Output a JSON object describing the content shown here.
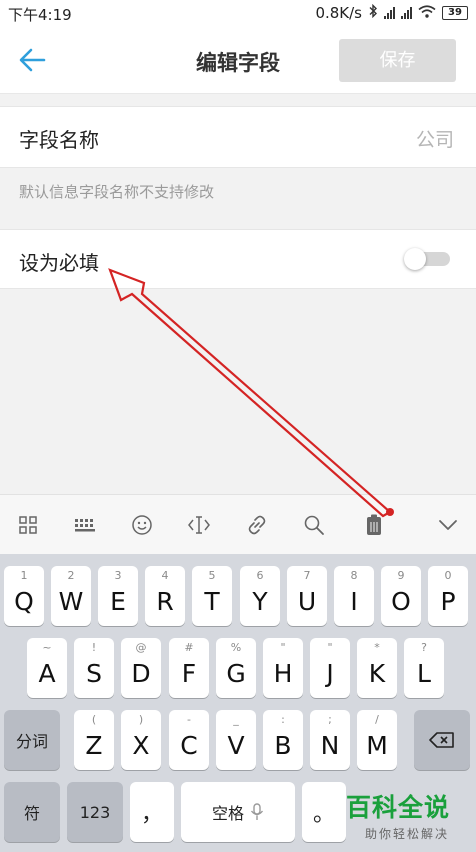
{
  "status_bar": {
    "time": "下午4:19",
    "speed": "0.8K/s",
    "battery": "39"
  },
  "header": {
    "title": "编辑字段",
    "save_label": "保存",
    "accent_color": "#2f9fdc"
  },
  "form": {
    "field_name_label": "字段名称",
    "field_name_value": "公司",
    "hint": "默认信息字段名称不支持修改",
    "required_label": "设为必填",
    "required_on": false
  },
  "keyboard": {
    "toolbar": [
      "grid-icon",
      "keyboard-icon",
      "emoji-icon",
      "cursor-icon",
      "link-icon",
      "search-icon",
      "clipboard-icon",
      "collapse-icon"
    ],
    "row1": [
      {
        "main": "Q",
        "sub": "1"
      },
      {
        "main": "W",
        "sub": "2"
      },
      {
        "main": "E",
        "sub": "3"
      },
      {
        "main": "R",
        "sub": "4"
      },
      {
        "main": "T",
        "sub": "5"
      },
      {
        "main": "Y",
        "sub": "6"
      },
      {
        "main": "U",
        "sub": "7"
      },
      {
        "main": "I",
        "sub": "8"
      },
      {
        "main": "O",
        "sub": "9"
      },
      {
        "main": "P",
        "sub": "0"
      }
    ],
    "row2": [
      {
        "main": "A",
        "sub": "~"
      },
      {
        "main": "S",
        "sub": "!"
      },
      {
        "main": "D",
        "sub": "@"
      },
      {
        "main": "F",
        "sub": "#"
      },
      {
        "main": "G",
        "sub": "%"
      },
      {
        "main": "H",
        "sub": "\""
      },
      {
        "main": "J",
        "sub": "\""
      },
      {
        "main": "K",
        "sub": "*"
      },
      {
        "main": "L",
        "sub": "?"
      }
    ],
    "row3": [
      {
        "main": "Z",
        "sub": "("
      },
      {
        "main": "X",
        "sub": ")"
      },
      {
        "main": "C",
        "sub": "-"
      },
      {
        "main": "V",
        "sub": "_"
      },
      {
        "main": "B",
        "sub": ":"
      },
      {
        "main": "N",
        "sub": ";"
      },
      {
        "main": "M",
        "sub": "/"
      }
    ],
    "fenci": "分词",
    "fu": "符",
    "num": "123",
    "comma": "，",
    "space": "空格",
    "period": "。"
  },
  "watermark": {
    "main": "百科全说",
    "sub": "助你轻松解决"
  }
}
